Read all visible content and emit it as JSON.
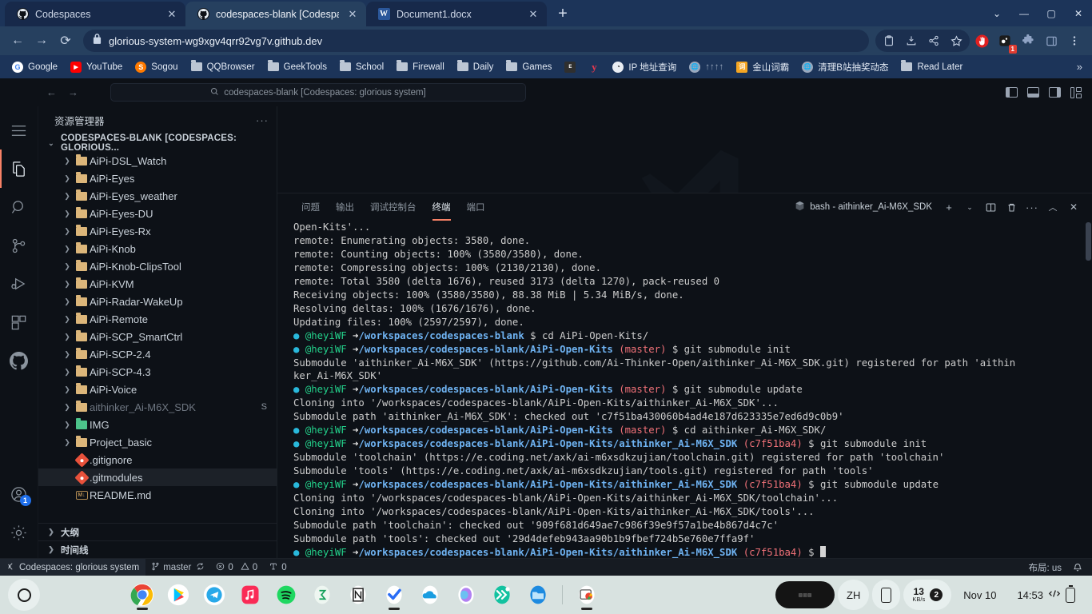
{
  "browser": {
    "tabs": [
      {
        "title": "Codespaces",
        "favicon": "github-icon",
        "active": false
      },
      {
        "title": "codespaces-blank [Codespaces:",
        "favicon": "github-icon",
        "active": true
      },
      {
        "title": "Document1.docx",
        "favicon": "word-icon",
        "active": false
      }
    ],
    "new_tab_label": "+",
    "window_controls": {
      "chevron": "⌄",
      "minimize": "—",
      "maximize": "▢",
      "close": "✕"
    },
    "nav": {
      "back": "←",
      "forward": "→",
      "reload": "⟳"
    },
    "omnibox": {
      "lock": "lock-icon",
      "url": "glorious-system-wg9xgv4qrr92vg7v.github.dev"
    },
    "toolbar_icons": [
      "clipboard-icon",
      "download-icon",
      "share-icon",
      "bookmark-star-icon",
      "adblock-icon",
      "extension-badge-icon",
      "puzzle-icon",
      "side-panel-icon",
      "browser-menu-icon"
    ],
    "extension_badge": "1",
    "bookmarks": [
      {
        "label": "Google",
        "icon": "google-icon"
      },
      {
        "label": "YouTube",
        "icon": "youtube-icon"
      },
      {
        "label": "Sogou",
        "icon": "sogou-icon"
      },
      {
        "label": "QQBrowser",
        "icon": "folder-icon"
      },
      {
        "label": "GeekTools",
        "icon": "folder-icon"
      },
      {
        "label": "School",
        "icon": "folder-icon"
      },
      {
        "label": "Firewall",
        "icon": "folder-icon"
      },
      {
        "label": "Daily",
        "icon": "folder-icon"
      },
      {
        "label": "Games",
        "icon": "folder-icon"
      },
      {
        "label": "",
        "icon": "epic-icon"
      },
      {
        "label": "",
        "icon": "y-icon"
      },
      {
        "label": "IP 地址查询",
        "icon": "ip-icon"
      },
      {
        "label": "↑↑↑↑",
        "icon": "globe-icon"
      },
      {
        "label": "金山词霸",
        "icon": "kingsoft-icon"
      },
      {
        "label": "清理B站抽奖动态",
        "icon": "globe-icon"
      },
      {
        "label": "Read Later",
        "icon": "folder-icon"
      }
    ],
    "bookmarks_overflow": "»"
  },
  "vscode": {
    "titlebar": {
      "back": "←",
      "forward": "→",
      "quickinput_icon": "search-icon",
      "quickinput_text": "codespaces-blank [Codespaces: glorious system]",
      "layout_icons": [
        "toggle-primary-sidebar-icon",
        "toggle-panel-icon",
        "toggle-secondary-sidebar-icon",
        "customize-layout-icon"
      ]
    },
    "activitybar": {
      "menu": "menu-icon",
      "items": [
        {
          "name": "explorer-icon",
          "active": true
        },
        {
          "name": "search-icon",
          "active": false
        },
        {
          "name": "source-control-icon",
          "active": false
        },
        {
          "name": "run-and-debug-icon",
          "active": false
        },
        {
          "name": "extensions-icon",
          "active": false
        },
        {
          "name": "github-icon",
          "active": false
        }
      ],
      "bottom": [
        {
          "name": "accounts-icon",
          "badge": "1"
        },
        {
          "name": "settings-gear-icon",
          "badge": ""
        }
      ]
    },
    "sidebar": {
      "title": "资源管理器",
      "more_actions": "···",
      "root_label": "CODESPACES-BLANK [CODESPACES: GLORIOUS...",
      "tree": [
        {
          "name": "AiPi-DSL_Watch",
          "type": "folder",
          "status": ""
        },
        {
          "name": "AiPi-Eyes",
          "type": "folder",
          "status": ""
        },
        {
          "name": "AiPi-Eyes_weather",
          "type": "folder",
          "status": ""
        },
        {
          "name": "AiPi-Eyes-DU",
          "type": "folder",
          "status": ""
        },
        {
          "name": "AiPi-Eyes-Rx",
          "type": "folder",
          "status": ""
        },
        {
          "name": "AiPi-Knob",
          "type": "folder",
          "status": ""
        },
        {
          "name": "AiPi-Knob-ClipsTool",
          "type": "folder",
          "status": ""
        },
        {
          "name": "AiPi-KVM",
          "type": "folder",
          "status": ""
        },
        {
          "name": "AiPi-Radar-WakeUp",
          "type": "folder",
          "status": ""
        },
        {
          "name": "AiPi-Remote",
          "type": "folder",
          "status": ""
        },
        {
          "name": "AiPi-SCP_SmartCtrl",
          "type": "folder",
          "status": ""
        },
        {
          "name": "AiPi-SCP-2.4",
          "type": "folder",
          "status": ""
        },
        {
          "name": "AiPi-SCP-4.3",
          "type": "folder",
          "status": ""
        },
        {
          "name": "AiPi-Voice",
          "type": "folder",
          "status": ""
        },
        {
          "name": "aithinker_Ai-M6X_SDK",
          "type": "folder-dim",
          "status": "S"
        },
        {
          "name": "IMG",
          "type": "folder-img",
          "status": ""
        },
        {
          "name": "Project_basic",
          "type": "folder",
          "status": ""
        },
        {
          "name": ".gitignore",
          "type": "git",
          "status": ""
        },
        {
          "name": ".gitmodules",
          "type": "git",
          "status": "",
          "selected": true
        },
        {
          "name": "README.md",
          "type": "md",
          "status": ""
        }
      ],
      "sections": [
        "大纲",
        "时间线"
      ]
    },
    "panel": {
      "tabs": [
        {
          "label": "问题",
          "active": false
        },
        {
          "label": "输出",
          "active": false
        },
        {
          "label": "调试控制台",
          "active": false
        },
        {
          "label": "终端",
          "active": true
        },
        {
          "label": "端口",
          "active": false
        }
      ],
      "terminal_name": "bash - aithinker_Ai-M6X_SDK",
      "actions": [
        "new-terminal-icon",
        "terminal-dropdown-icon",
        "split-terminal-icon",
        "kill-terminal-icon",
        "panel-more-icon",
        "maximize-panel-icon",
        "close-panel-icon"
      ]
    },
    "terminal_lines": [
      {
        "type": "plain",
        "text": "Open-Kits'..."
      },
      {
        "type": "plain",
        "text": "remote: Enumerating objects: 3580, done."
      },
      {
        "type": "plain",
        "text": "remote: Counting objects: 100% (3580/3580), done."
      },
      {
        "type": "plain",
        "text": "remote: Compressing objects: 100% (2130/2130), done."
      },
      {
        "type": "plain",
        "text": "remote: Total 3580 (delta 1676), reused 3173 (delta 1270), pack-reused 0"
      },
      {
        "type": "plain",
        "text": "Receiving objects: 100% (3580/3580), 88.38 MiB | 5.34 MiB/s, done."
      },
      {
        "type": "plain",
        "text": "Resolving deltas: 100% (1676/1676), done."
      },
      {
        "type": "plain",
        "text": "Updating files: 100% (2597/2597), done."
      },
      {
        "type": "prompt",
        "user": "@heyiWF",
        "path": "/workspaces/codespaces-blank",
        "branch": "",
        "cmd": "cd AiPi-Open-Kits/"
      },
      {
        "type": "prompt",
        "user": "@heyiWF",
        "path": "/workspaces/codespaces-blank/AiPi-Open-Kits",
        "branch": "master",
        "cmd": "git submodule init"
      },
      {
        "type": "plain",
        "text": "Submodule 'aithinker_Ai-M6X_SDK' (https://github.com/Ai-Thinker-Open/aithinker_Ai-M6X_SDK.git) registered for path 'aithin"
      },
      {
        "type": "plain",
        "text": "ker_Ai-M6X_SDK'"
      },
      {
        "type": "prompt",
        "user": "@heyiWF",
        "path": "/workspaces/codespaces-blank/AiPi-Open-Kits",
        "branch": "master",
        "cmd": "git submodule update"
      },
      {
        "type": "plain",
        "text": "Cloning into '/workspaces/codespaces-blank/AiPi-Open-Kits/aithinker_Ai-M6X_SDK'..."
      },
      {
        "type": "plain",
        "text": "Submodule path 'aithinker_Ai-M6X_SDK': checked out 'c7f51ba430060b4ad4e187d623335e7ed6d9c0b9'"
      },
      {
        "type": "prompt",
        "user": "@heyiWF",
        "path": "/workspaces/codespaces-blank/AiPi-Open-Kits",
        "branch": "master",
        "cmd": "cd aithinker_Ai-M6X_SDK/"
      },
      {
        "type": "prompt",
        "user": "@heyiWF",
        "path": "/workspaces/codespaces-blank/AiPi-Open-Kits/aithinker_Ai-M6X_SDK",
        "branch": "c7f51ba4",
        "cmd": "git submodule init"
      },
      {
        "type": "plain",
        "text": "Submodule 'toolchain' (https://e.coding.net/axk/ai-m6xsdkzujian/toolchain.git) registered for path 'toolchain'"
      },
      {
        "type": "plain",
        "text": "Submodule 'tools' (https://e.coding.net/axk/ai-m6xsdkzujian/tools.git) registered for path 'tools'"
      },
      {
        "type": "prompt",
        "user": "@heyiWF",
        "path": "/workspaces/codespaces-blank/AiPi-Open-Kits/aithinker_Ai-M6X_SDK",
        "branch": "c7f51ba4",
        "cmd": "git submodule update"
      },
      {
        "type": "plain",
        "text": "Cloning into '/workspaces/codespaces-blank/AiPi-Open-Kits/aithinker_Ai-M6X_SDK/toolchain'..."
      },
      {
        "type": "plain",
        "text": "Cloning into '/workspaces/codespaces-blank/AiPi-Open-Kits/aithinker_Ai-M6X_SDK/tools'..."
      },
      {
        "type": "plain",
        "text": "Submodule path 'toolchain': checked out '909f681d649ae7c986f39e9f57a1be4b867d4c7c'"
      },
      {
        "type": "plain",
        "text": "Submodule path 'tools': checked out '29d4defeb943aa90b1b9fbef724b5e760e7ffa9f'"
      },
      {
        "type": "prompt",
        "user": "@heyiWF",
        "path": "/workspaces/codespaces-blank/AiPi-Open-Kits/aithinker_Ai-M6X_SDK",
        "branch": "c7f51ba4",
        "cmd": "",
        "cursor": true
      }
    ],
    "statusbar": {
      "remote": "Codespaces: glorious system",
      "branch": "master",
      "sync_icon": "sync-icon",
      "errors": "0",
      "warnings": "0",
      "ports": "0",
      "layout": "布局: us",
      "bell": "bell-icon"
    }
  },
  "taskbar": {
    "start": "start-icon",
    "apps": [
      {
        "name": "chrome-icon",
        "running": true
      },
      {
        "name": "play-store-icon",
        "running": false
      },
      {
        "name": "telegram-icon",
        "running": false
      },
      {
        "name": "apple-music-icon",
        "running": false
      },
      {
        "name": "spotify-icon",
        "running": false
      },
      {
        "name": "sigma-icon",
        "running": false
      },
      {
        "name": "notion-icon",
        "running": false
      },
      {
        "name": "todoist-icon",
        "running": true
      },
      {
        "name": "onedrive-icon",
        "running": false
      },
      {
        "name": "copilot-icon",
        "running": false
      },
      {
        "name": "fast-forward-icon",
        "running": false
      },
      {
        "name": "file-explorer-icon",
        "running": false
      },
      {
        "name": "chrome-apps-icon",
        "running": true
      }
    ],
    "tray": {
      "widget": "",
      "language": "ZH",
      "phone_icon": "phone-link-icon",
      "net_rate": "13",
      "net_unit": "KB/s",
      "net_badge": "2",
      "date": "Nov 10",
      "time": "14:53",
      "network_icon": "network-icon",
      "battery_icon": "battery-icon"
    }
  },
  "colors": {
    "browser_chrome": "#1c3459",
    "toolbar": "#26405f",
    "vscode_bg": "#0d1117",
    "accent_orange": "#f78166",
    "terminal_green": "#23d18b",
    "terminal_blue": "#6fb3f2",
    "terminal_red": "#f07178",
    "taskbar": "#d8e2e0"
  }
}
